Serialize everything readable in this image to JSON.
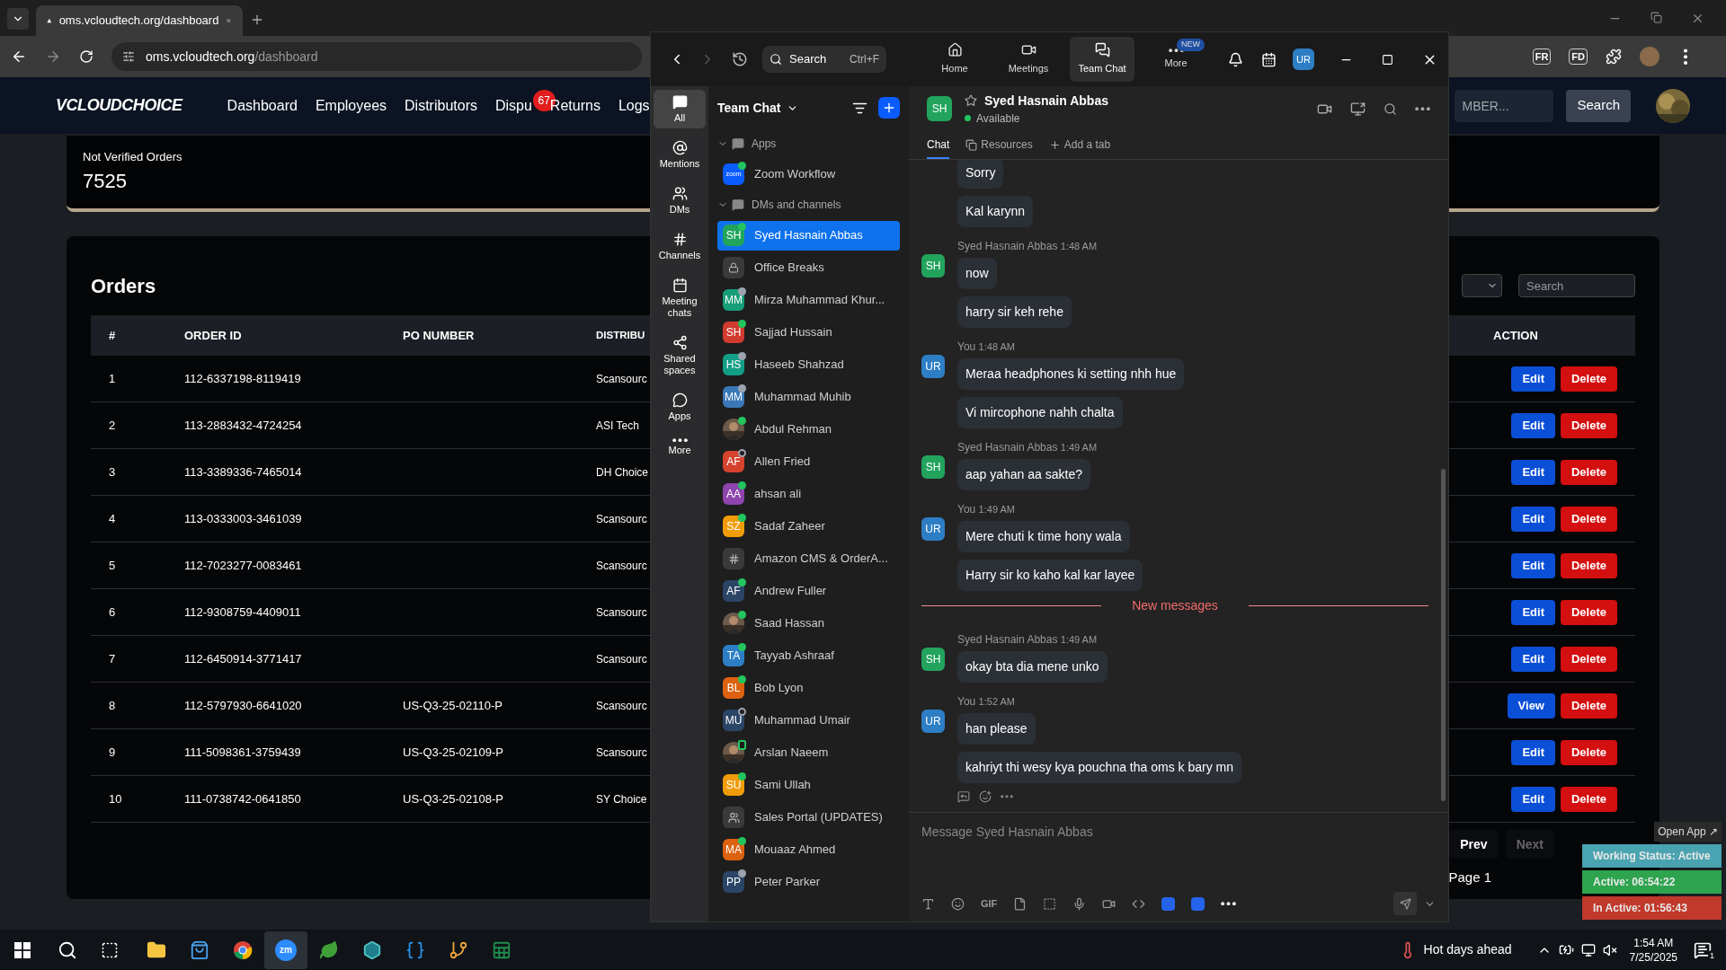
{
  "browser": {
    "tab_title": "oms.vcloudtech.org/dashboard",
    "url_host": "oms.vcloudtech.org",
    "url_path": "/dashboard",
    "extensions": [
      "FR",
      "FD"
    ]
  },
  "site": {
    "logo": "VCLOUDCHOICE",
    "nav": [
      {
        "label": "Dashboard"
      },
      {
        "label": "Employees"
      },
      {
        "label": "Distributors"
      },
      {
        "label": "Dispu",
        "badge": "67"
      },
      {
        "label": "Returns"
      },
      {
        "label": "Logs"
      }
    ],
    "search_placeholder": "MBER...",
    "search_button": "Search"
  },
  "stat_card": {
    "label": "Not Verified Orders",
    "value": "7525"
  },
  "orders": {
    "title": "Orders",
    "search_placeholder": "Search",
    "columns": [
      "#",
      "ORDER ID",
      "PO NUMBER",
      "DISTRIBU",
      "ACTION"
    ],
    "rows": [
      {
        "n": "1",
        "order_id": "112-6337198-8119419",
        "po": "",
        "distributor": "Scansourc",
        "action": "Edit",
        "delete": "Delete"
      },
      {
        "n": "2",
        "order_id": "113-2883432-4724254",
        "po": "",
        "distributor": "ASI Tech",
        "action": "Edit",
        "delete": "Delete"
      },
      {
        "n": "3",
        "order_id": "113-3389336-7465014",
        "po": "",
        "distributor": "DH Choice",
        "action": "Edit",
        "delete": "Delete"
      },
      {
        "n": "4",
        "order_id": "113-0333003-3461039",
        "po": "",
        "distributor": "Scansourc",
        "action": "Edit",
        "delete": "Delete"
      },
      {
        "n": "5",
        "order_id": "112-7023277-0083461",
        "po": "",
        "distributor": "Scansourc",
        "action": "Edit",
        "delete": "Delete"
      },
      {
        "n": "6",
        "order_id": "112-9308759-4409011",
        "po": "",
        "distributor": "Scansourc",
        "action": "Edit",
        "delete": "Delete"
      },
      {
        "n": "7",
        "order_id": "112-6450914-3771417",
        "po": "",
        "distributor": "Scansourc",
        "action": "Edit",
        "delete": "Delete"
      },
      {
        "n": "8",
        "order_id": "112-5797930-6641020",
        "po": "US-Q3-25-02110-P",
        "distributor": "Scansourc",
        "action": "View",
        "delete": "Delete"
      },
      {
        "n": "9",
        "order_id": "111-5098361-3759439",
        "po": "US-Q3-25-02109-P",
        "distributor": "Scansourc",
        "action": "Edit",
        "delete": "Delete"
      },
      {
        "n": "10",
        "order_id": "111-0738742-0641850",
        "po": "US-Q3-25-02108-P",
        "distributor": "SY Choice",
        "action": "Edit",
        "delete": "Delete"
      }
    ],
    "pagination": {
      "prev": {
        "label": "Prev",
        "disabled": false
      },
      "next": {
        "label": "Next",
        "disabled": true
      },
      "page": "Page 1"
    }
  },
  "zoom": {
    "search": {
      "label": "Search",
      "shortcut": "Ctrl+F"
    },
    "tabs": [
      {
        "label": "Home",
        "kind": "home",
        "selected": false
      },
      {
        "label": "Meetings",
        "kind": "video",
        "selected": false
      },
      {
        "label": "Team Chat",
        "kind": "chat",
        "selected": true
      },
      {
        "label": "More",
        "kind": "more",
        "selected": false,
        "badge": "NEW"
      }
    ],
    "user_initials": "UR",
    "rail": [
      {
        "label": "All",
        "kind": "chat",
        "selected": true
      },
      {
        "label": "Mentions",
        "kind": "at",
        "selected": false
      },
      {
        "label": "DMs",
        "kind": "people",
        "selected": false
      },
      {
        "label": "Channels",
        "kind": "hash",
        "selected": false
      },
      {
        "label": "Meeting chats",
        "kind": "calendar",
        "selected": false
      },
      {
        "label": "Shared spaces",
        "kind": "share",
        "selected": false
      },
      {
        "label": "Apps",
        "kind": "apps",
        "selected": false
      },
      {
        "label": "More",
        "kind": "more",
        "selected": false
      }
    ],
    "list_title": "Team Chat",
    "sections": [
      {
        "title": "Apps",
        "expanded": true,
        "items": [
          {
            "name": "Zoom Workflow",
            "kind": "app",
            "icon_text": "zoom",
            "dot": {
              "kind": "filled",
              "color": "#22c55e"
            },
            "selected": false
          }
        ]
      },
      {
        "title": "DMs and channels",
        "expanded": true,
        "items": [
          {
            "name": "Syed Hasnain Abbas",
            "kind": "initials",
            "initials": "SH",
            "color": "#22a45d",
            "dot": {
              "kind": "filled",
              "color": "#22c55e"
            },
            "selected": true
          },
          {
            "name": "Office Breaks",
            "kind": "lock",
            "selected": false
          },
          {
            "name": "Mirza Muhammad Khur...",
            "kind": "initials",
            "initials": "MM",
            "color": "#169e78",
            "dot": {
              "kind": "filled",
              "color": "#9ca3af"
            },
            "selected": false
          },
          {
            "name": "Sajjad Hussain",
            "kind": "initials",
            "initials": "SH",
            "color": "#d13b2f",
            "dot": {
              "kind": "filled",
              "color": "#22c55e"
            },
            "selected": false
          },
          {
            "name": "Haseeb Shahzad",
            "kind": "initials",
            "initials": "HS",
            "color": "#139e86",
            "dot": {
              "kind": "filled",
              "color": "#9ca3af"
            },
            "selected": false
          },
          {
            "name": "Muhammad Muhib",
            "kind": "initials",
            "initials": "MM",
            "color": "#3a78b8",
            "dot": {
              "kind": "filled",
              "color": "#9ca3af"
            },
            "selected": false
          },
          {
            "name": "Abdul Rehman",
            "dot": {
              "kind": "filled",
              "color": "#22c55e"
            },
            "selected": false
          },
          {
            "name": "Allen Fried",
            "kind": "initials",
            "initials": "AF",
            "color": "#d5432f",
            "dot": {
              "kind": "ring",
              "color": "#9ca3af"
            },
            "selected": false
          },
          {
            "name": "ahsan ali",
            "kind": "initials",
            "initials": "AA",
            "color": "#8e44ad",
            "dot": {
              "kind": "filled",
              "color": "#22c55e"
            },
            "selected": false
          },
          {
            "name": "Sadaf Zaheer",
            "kind": "initials",
            "initials": "SZ",
            "color": "#f09c0a",
            "dot": {
              "kind": "filled",
              "color": "#22c55e"
            },
            "selected": false
          },
          {
            "name": "Amazon CMS & OrderA...",
            "kind": "hash",
            "selected": false
          },
          {
            "name": "Andrew Fuller",
            "kind": "initials",
            "initials": "AF",
            "color": "#2b4566",
            "dot": {
              "kind": "filled",
              "color": "#22c55e"
            },
            "selected": false
          },
          {
            "name": "Saad Hassan",
            "dot": {
              "kind": "filled",
              "color": "#22c55e"
            },
            "selected": false
          },
          {
            "name": "Tayyab Ashraaf",
            "kind": "initials",
            "initials": "TA",
            "color": "#2e7ec6",
            "dot": {
              "kind": "filled",
              "color": "#22c55e"
            },
            "selected": false
          },
          {
            "name": "Bob Lyon",
            "kind": "initials",
            "initials": "BL",
            "color": "#dd620f",
            "dot": {
              "kind": "filled",
              "color": "#22c55e"
            },
            "selected": false
          },
          {
            "name": "Muhammad Umair",
            "kind": "initials",
            "initials": "MU",
            "color": "#2b4566",
            "dot": {
              "kind": "ring",
              "color": "#9ca3af"
            },
            "selected": false
          },
          {
            "name": "Arslan Naeem",
            "dot": {
              "kind": "phone",
              "color": "#22c55e"
            },
            "selected": false
          },
          {
            "name": "Sami Ullah",
            "kind": "initials",
            "initials": "SU",
            "color": "#f09c0a",
            "dot": {
              "kind": "filled",
              "color": "#22c55e"
            },
            "selected": false
          },
          {
            "name": "Sales Portal (UPDATES)",
            "kind": "group",
            "selected": false
          },
          {
            "name": "Mouaaz Ahmed",
            "kind": "initials",
            "initials": "MA",
            "color": "#dd620f",
            "dot": {
              "kind": "filled",
              "color": "#22c55e"
            },
            "selected": false
          },
          {
            "name": "Peter Parker",
            "kind": "initials",
            "initials": "PP",
            "color": "#2b4566",
            "dot": {
              "kind": "filled",
              "color": "#9ca3af"
            },
            "selected": false
          }
        ]
      }
    ],
    "chat": {
      "initials": "SH",
      "color": "#22a45d",
      "name": "Syed Hasnain Abbas",
      "status": "Available",
      "tabs": [
        {
          "label": "Chat",
          "kind": "chat",
          "selected": true
        },
        {
          "label": "Resources",
          "kind": "files",
          "selected": false
        },
        {
          "label": "Add a tab",
          "kind": "add",
          "selected": false
        }
      ],
      "messages": [
        {
          "kind": "group",
          "bubbles": [
            "Sorry",
            "Kal karynn"
          ]
        },
        {
          "kind": "group",
          "sender": "Syed Hasnain Abbas",
          "time": "1:48 AM",
          "initials": "SH",
          "color": "#22a45d",
          "bubbles": [
            "now",
            "harry sir keh rehe"
          ]
        },
        {
          "kind": "group",
          "sender": "You",
          "time": "1:48 AM",
          "initials": "UR",
          "color": "#2d7ec4",
          "bubbles": [
            "Meraa headphones ki setting nhh hue",
            "Vi mircophone nahh chalta"
          ]
        },
        {
          "kind": "group",
          "sender": "Syed Hasnain Abbas",
          "time": "1:49 AM",
          "initials": "SH",
          "color": "#22a45d",
          "bubbles": [
            "aap yahan aa sakte?"
          ]
        },
        {
          "kind": "group",
          "sender": "You",
          "time": "1:49 AM",
          "initials": "UR",
          "color": "#2d7ec4",
          "bubbles": [
            "Mere chuti k time hony wala",
            "Harry sir ko kaho kal kar layee"
          ]
        },
        {
          "kind": "divider",
          "label": "New messages"
        },
        {
          "kind": "group",
          "sender": "Syed Hasnain Abbas",
          "time": "1:49 AM",
          "initials": "SH",
          "color": "#22a45d",
          "bubbles": [
            "okay bta dia mene unko"
          ]
        },
        {
          "kind": "group",
          "sender": "You",
          "time": "1:52 AM",
          "initials": "UR",
          "color": "#2d7ec4",
          "bubbles": [
            "han please",
            "kahriyt thi wesy kya pouchna tha oms k bary mn"
          ],
          "reactions": true
        }
      ],
      "composer": {
        "placeholder": "Message Syed Hasnain Abbas",
        "gif": "GIF"
      }
    }
  },
  "widget": {
    "open_app": "Open App ↗",
    "rows": [
      {
        "label": "Working Status: Active",
        "color": "#4aa3b0"
      },
      {
        "label": "Active: 06:54:22",
        "color": "#2ea44f"
      },
      {
        "label": "In Active: 01:56:43",
        "color": "#c0392b"
      }
    ]
  },
  "taskbar": {
    "apps": [
      {
        "kind": "folder",
        "selected": false
      },
      {
        "kind": "store",
        "selected": false
      },
      {
        "kind": "chrome",
        "selected": false
      },
      {
        "kind": "zoom",
        "label": "zm",
        "selected": true
      },
      {
        "kind": "leaf",
        "selected": false
      },
      {
        "kind": "gem",
        "selected": false
      },
      {
        "kind": "code",
        "selected": false
      },
      {
        "kind": "git",
        "selected": false
      },
      {
        "kind": "sheet",
        "selected": false
      }
    ],
    "weather": "Hot days ahead",
    "time": "1:54 AM",
    "date": "7/25/2025",
    "notifications": "1"
  }
}
